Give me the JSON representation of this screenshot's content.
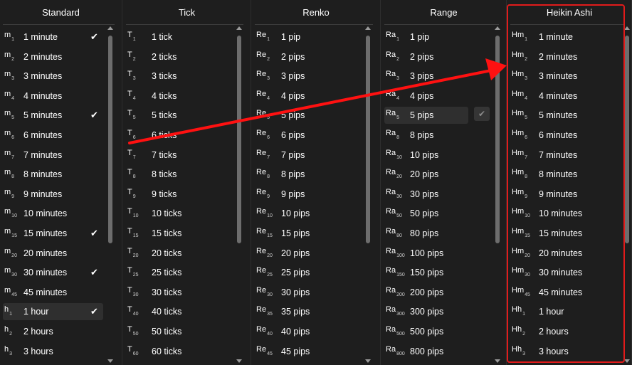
{
  "panels": [
    {
      "title": "Standard",
      "items": [
        {
          "prefix": "m",
          "sub": "1",
          "label": "1 minute",
          "checked": true
        },
        {
          "prefix": "m",
          "sub": "2",
          "label": "2 minutes"
        },
        {
          "prefix": "m",
          "sub": "3",
          "label": "3 minutes"
        },
        {
          "prefix": "m",
          "sub": "4",
          "label": "4 minutes"
        },
        {
          "prefix": "m",
          "sub": "5",
          "label": "5 minutes",
          "checked": true
        },
        {
          "prefix": "m",
          "sub": "6",
          "label": "6 minutes"
        },
        {
          "prefix": "m",
          "sub": "7",
          "label": "7 minutes"
        },
        {
          "prefix": "m",
          "sub": "8",
          "label": "8 minutes"
        },
        {
          "prefix": "m",
          "sub": "9",
          "label": "9 minutes"
        },
        {
          "prefix": "m",
          "sub": "10",
          "label": "10 minutes"
        },
        {
          "prefix": "m",
          "sub": "15",
          "label": "15 minutes",
          "checked": true
        },
        {
          "prefix": "m",
          "sub": "20",
          "label": "20 minutes"
        },
        {
          "prefix": "m",
          "sub": "30",
          "label": "30 minutes",
          "checked": true
        },
        {
          "prefix": "m",
          "sub": "45",
          "label": "45 minutes"
        },
        {
          "prefix": "h",
          "sub": "1",
          "label": "1 hour",
          "checked": true,
          "selected": true
        },
        {
          "prefix": "h",
          "sub": "2",
          "label": "2 hours"
        },
        {
          "prefix": "h",
          "sub": "3",
          "label": "3 hours"
        }
      ]
    },
    {
      "title": "Tick",
      "items": [
        {
          "prefix": "T",
          "sub": "1",
          "label": "1 tick"
        },
        {
          "prefix": "T",
          "sub": "2",
          "label": "2 ticks"
        },
        {
          "prefix": "T",
          "sub": "3",
          "label": "3 ticks"
        },
        {
          "prefix": "T",
          "sub": "4",
          "label": "4 ticks"
        },
        {
          "prefix": "T",
          "sub": "5",
          "label": "5 ticks"
        },
        {
          "prefix": "T",
          "sub": "6",
          "label": "6 ticks"
        },
        {
          "prefix": "T",
          "sub": "7",
          "label": "7 ticks"
        },
        {
          "prefix": "T",
          "sub": "8",
          "label": "8 ticks"
        },
        {
          "prefix": "T",
          "sub": "9",
          "label": "9 ticks"
        },
        {
          "prefix": "T",
          "sub": "10",
          "label": "10 ticks"
        },
        {
          "prefix": "T",
          "sub": "15",
          "label": "15 ticks"
        },
        {
          "prefix": "T",
          "sub": "20",
          "label": "20 ticks"
        },
        {
          "prefix": "T",
          "sub": "25",
          "label": "25 ticks"
        },
        {
          "prefix": "T",
          "sub": "30",
          "label": "30 ticks"
        },
        {
          "prefix": "T",
          "sub": "40",
          "label": "40 ticks"
        },
        {
          "prefix": "T",
          "sub": "50",
          "label": "50 ticks"
        },
        {
          "prefix": "T",
          "sub": "60",
          "label": "60 ticks"
        }
      ]
    },
    {
      "title": "Renko",
      "items": [
        {
          "prefix": "Re",
          "sub": "1",
          "label": "1 pip"
        },
        {
          "prefix": "Re",
          "sub": "2",
          "label": "2 pips"
        },
        {
          "prefix": "Re",
          "sub": "3",
          "label": "3 pips"
        },
        {
          "prefix": "Re",
          "sub": "4",
          "label": "4 pips"
        },
        {
          "prefix": "Re",
          "sub": "5",
          "label": "5 pips"
        },
        {
          "prefix": "Re",
          "sub": "6",
          "label": "6 pips"
        },
        {
          "prefix": "Re",
          "sub": "7",
          "label": "7 pips"
        },
        {
          "prefix": "Re",
          "sub": "8",
          "label": "8 pips"
        },
        {
          "prefix": "Re",
          "sub": "9",
          "label": "9 pips"
        },
        {
          "prefix": "Re",
          "sub": "10",
          "label": "10 pips"
        },
        {
          "prefix": "Re",
          "sub": "15",
          "label": "15 pips"
        },
        {
          "prefix": "Re",
          "sub": "20",
          "label": "20 pips"
        },
        {
          "prefix": "Re",
          "sub": "25",
          "label": "25 pips"
        },
        {
          "prefix": "Re",
          "sub": "30",
          "label": "30 pips"
        },
        {
          "prefix": "Re",
          "sub": "35",
          "label": "35 pips"
        },
        {
          "prefix": "Re",
          "sub": "40",
          "label": "40 pips"
        },
        {
          "prefix": "Re",
          "sub": "45",
          "label": "45 pips"
        }
      ]
    },
    {
      "title": "Range",
      "items": [
        {
          "prefix": "Ra",
          "sub": "1",
          "label": "1 pip"
        },
        {
          "prefix": "Ra",
          "sub": "2",
          "label": "2 pips"
        },
        {
          "prefix": "Ra",
          "sub": "3",
          "label": "3 pips"
        },
        {
          "prefix": "Ra",
          "sub": "4",
          "label": "4 pips"
        },
        {
          "prefix": "Ra",
          "sub": "5",
          "label": "5 pips",
          "selected": true,
          "check_button": true
        },
        {
          "prefix": "Ra",
          "sub": "8",
          "label": "8 pips"
        },
        {
          "prefix": "Ra",
          "sub": "10",
          "label": "10 pips"
        },
        {
          "prefix": "Ra",
          "sub": "20",
          "label": "20 pips"
        },
        {
          "prefix": "Ra",
          "sub": "30",
          "label": "30 pips"
        },
        {
          "prefix": "Ra",
          "sub": "50",
          "label": "50 pips"
        },
        {
          "prefix": "Ra",
          "sub": "80",
          "label": "80 pips"
        },
        {
          "prefix": "Ra",
          "sub": "100",
          "label": "100 pips"
        },
        {
          "prefix": "Ra",
          "sub": "150",
          "label": "150 pips"
        },
        {
          "prefix": "Ra",
          "sub": "200",
          "label": "200 pips"
        },
        {
          "prefix": "Ra",
          "sub": "300",
          "label": "300 pips"
        },
        {
          "prefix": "Ra",
          "sub": "500",
          "label": "500 pips"
        },
        {
          "prefix": "Ra",
          "sub": "800",
          "label": "800 pips"
        }
      ]
    },
    {
      "title": "Heikin Ashi",
      "highlighted": true,
      "items": [
        {
          "prefix": "Hm",
          "sub": "1",
          "label": "1 minute"
        },
        {
          "prefix": "Hm",
          "sub": "2",
          "label": "2 minutes"
        },
        {
          "prefix": "Hm",
          "sub": "3",
          "label": "3 minutes"
        },
        {
          "prefix": "Hm",
          "sub": "4",
          "label": "4 minutes"
        },
        {
          "prefix": "Hm",
          "sub": "5",
          "label": "5 minutes"
        },
        {
          "prefix": "Hm",
          "sub": "6",
          "label": "6 minutes"
        },
        {
          "prefix": "Hm",
          "sub": "7",
          "label": "7 minutes"
        },
        {
          "prefix": "Hm",
          "sub": "8",
          "label": "8 minutes"
        },
        {
          "prefix": "Hm",
          "sub": "9",
          "label": "9 minutes"
        },
        {
          "prefix": "Hm",
          "sub": "10",
          "label": "10 minutes"
        },
        {
          "prefix": "Hm",
          "sub": "15",
          "label": "15 minutes"
        },
        {
          "prefix": "Hm",
          "sub": "20",
          "label": "20 minutes"
        },
        {
          "prefix": "Hm",
          "sub": "30",
          "label": "30 minutes"
        },
        {
          "prefix": "Hm",
          "sub": "45",
          "label": "45 minutes"
        },
        {
          "prefix": "Hh",
          "sub": "1",
          "label": "1 hour"
        },
        {
          "prefix": "Hh",
          "sub": "2",
          "label": "2 hours"
        },
        {
          "prefix": "Hh",
          "sub": "3",
          "label": "3 hours"
        }
      ]
    }
  ],
  "icons": {
    "check": "checkmark-icon",
    "scroll_up": "scroll-up-arrow-icon",
    "scroll_down": "scroll-down-arrow-icon"
  },
  "colors": {
    "background": "#1e1e1e",
    "selected_row": "#2f2f2f",
    "highlight": "#e21b1b",
    "annotation_arrow": "#ff1111"
  }
}
